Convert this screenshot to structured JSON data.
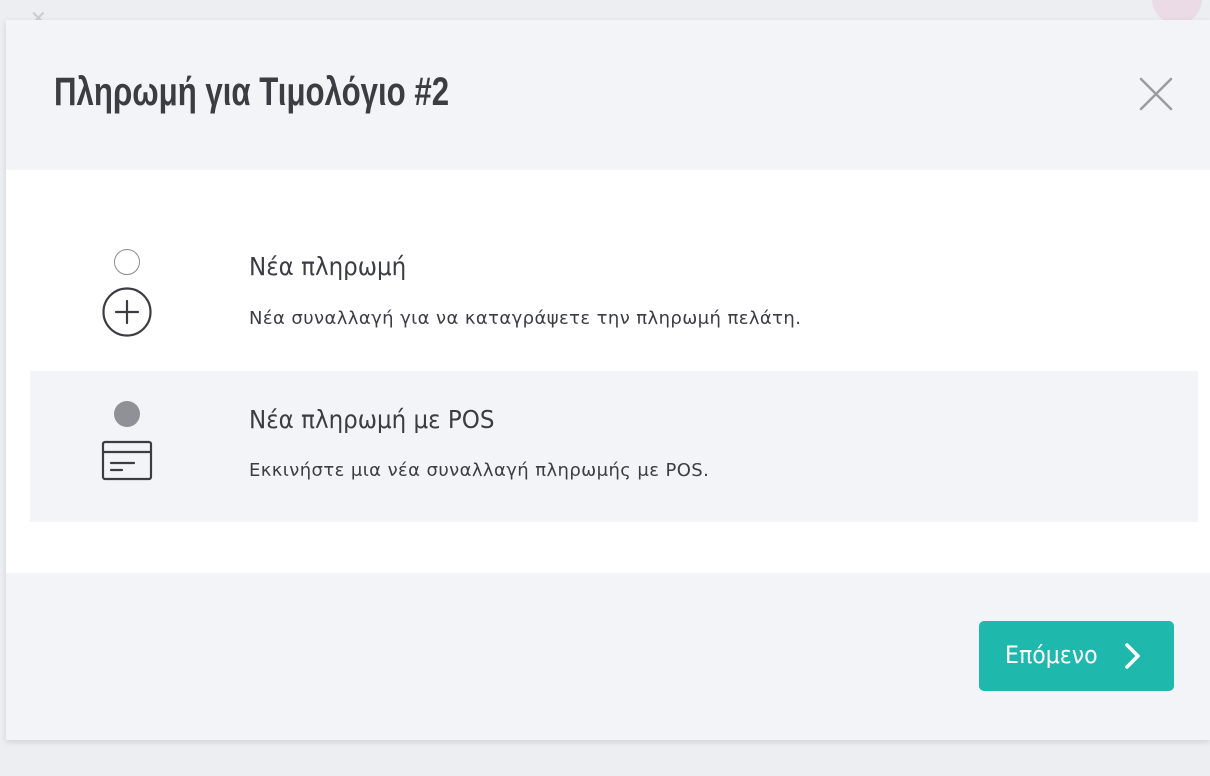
{
  "modal": {
    "title": "Πληρωμή για Τιμολόγιο #2",
    "close_icon": "close-icon"
  },
  "options": [
    {
      "title": "Νέα πληρωμή",
      "description": "Νέα συναλλαγή για να καταγράψετε την πληρωμή πελάτη.",
      "icon": "plus-circle-icon",
      "selected": false
    },
    {
      "title": "Νέα πληρωμή με POS",
      "description": "Εκκινήστε μια νέα συναλλαγή πληρωμής με POS.",
      "icon": "card-terminal-icon",
      "selected": true
    }
  ],
  "footer": {
    "next_label": "Επόμενο",
    "next_icon": "chevron-right-icon"
  },
  "colors": {
    "accent": "#1fb8ad",
    "text": "#3b3d42",
    "panel": "#f3f4f8",
    "radio_selected": "#8f9196"
  }
}
